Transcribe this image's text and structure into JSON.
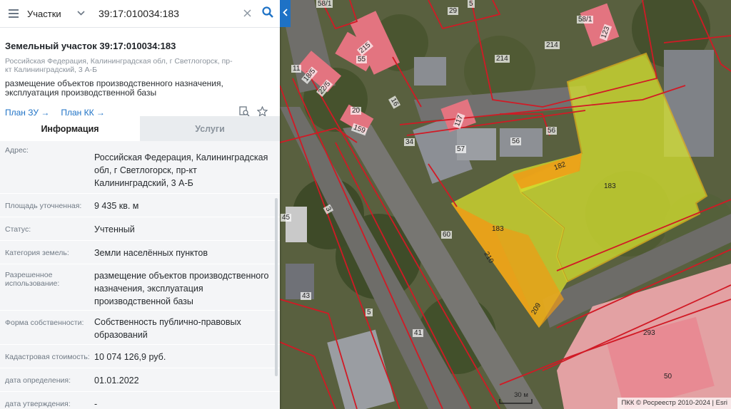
{
  "search": {
    "layer": "Участки",
    "query": "39:17:010034:183"
  },
  "parcel": {
    "title": "Земельный участок 39:17:010034:183",
    "address_short": "Российская Федерация, Калининградская обл, г Светлогорск, пр-кт Калининградский, 3 А-Б",
    "purpose": "размещение объектов производственного назначения, эксплуатация производственной базы",
    "plan_zu": "План ЗУ →",
    "plan_kk": "План КК →"
  },
  "tabs": {
    "info": "Информация",
    "services": "Услуги"
  },
  "details": [
    {
      "label": "Адрес:",
      "value": "Российская Федерация, Калининградская обл, г Светлогорск, пр-кт Калининградский, 3 А-Б"
    },
    {
      "label": "Площадь уточненная:",
      "value": "9 435 кв. м"
    },
    {
      "label": "Статус:",
      "value": "Учтенный"
    },
    {
      "label": "Категория земель:",
      "value": "Земли населённых пунктов"
    },
    {
      "label": "Разрешенное использование:",
      "value": "размещение объектов производственного назначения, эксплуатация производственной базы"
    },
    {
      "label": "Форма собственности:",
      "value": "Собственность публично-правовых образований"
    },
    {
      "label": "Кадастровая стоимость:",
      "value": "10 074 126,9 руб."
    },
    {
      "label": "дата определения:",
      "value": "01.01.2022"
    },
    {
      "label": "дата утверждения:",
      "value": "-"
    }
  ],
  "map": {
    "labels": [
      "58/1",
      "29",
      "5",
      "58/1",
      "123",
      "214",
      "214",
      "11",
      "18/5",
      "22/5",
      "55",
      "215",
      "16",
      "20",
      "159",
      "117",
      "57",
      "56",
      "56",
      "34",
      "182",
      "183",
      "183",
      "210",
      "209",
      "60",
      "45",
      "3",
      "5",
      "43",
      "41",
      "293",
      "50"
    ],
    "scale": "30 м",
    "attribution": "ПКК © Росреестр 2010-2024 | Esri",
    "colors": {
      "selected_fill": "#d6e22f",
      "selected_orange": "#ee9a16",
      "boundary": "#d11a25",
      "building_pink": "#f0a0a8"
    }
  },
  "icons": [
    "menu-icon",
    "chevron-down-icon",
    "clear-icon",
    "search-icon",
    "measure-icon",
    "star-icon",
    "chevron-left-icon"
  ]
}
